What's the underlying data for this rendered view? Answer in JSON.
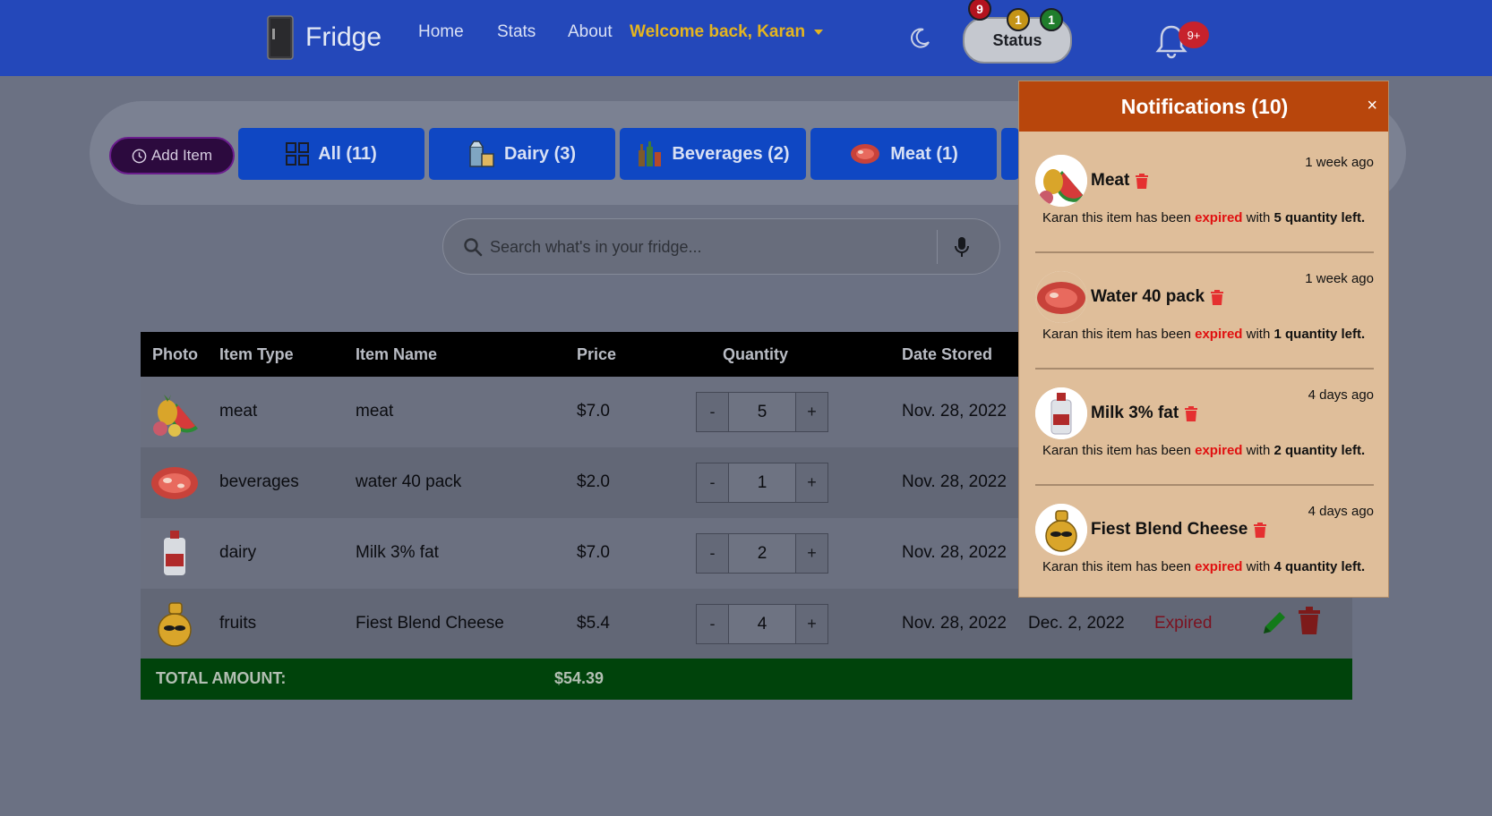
{
  "navbar": {
    "brand": "Fridge",
    "links": [
      "Home",
      "Stats",
      "About"
    ],
    "welcome": "Welcome back, Karan",
    "status_label": "Status",
    "status_badges": {
      "expired": "9",
      "warning": "1",
      "fresh": "1"
    },
    "notification_badge": "9+"
  },
  "filters": {
    "add_item": "Add Item",
    "categories": [
      "All (11)",
      "Dairy (3)",
      "Beverages (2)",
      "Meat (1)"
    ]
  },
  "search": {
    "placeholder": "Search what's in your fridge..."
  },
  "table": {
    "headers": [
      "Photo",
      "Item Type",
      "Item Name",
      "Price",
      "Quantity",
      "Date Stored"
    ],
    "rows": [
      {
        "type": "meat",
        "name": "meat",
        "price": "$7.0",
        "qty": "5",
        "stored": "Nov. 28, 2022",
        "expiry": "",
        "status": ""
      },
      {
        "type": "beverages",
        "name": "water 40 pack",
        "price": "$2.0",
        "qty": "1",
        "stored": "Nov. 28, 2022",
        "expiry": "",
        "status": ""
      },
      {
        "type": "dairy",
        "name": "Milk 3% fat",
        "price": "$7.0",
        "qty": "2",
        "stored": "Nov. 28, 2022",
        "expiry": "",
        "status": ""
      },
      {
        "type": "fruits",
        "name": "Fiest Blend Cheese",
        "price": "$5.4",
        "qty": "4",
        "stored": "Nov. 28, 2022",
        "expiry": "Dec. 2, 2022",
        "status": "Expired"
      }
    ],
    "qty_minus": "-",
    "qty_plus": "+",
    "total_label": "TOTAL AMOUNT:",
    "total_amount": "$54.39"
  },
  "notifications": {
    "title": "Notifications (10)",
    "close": "×",
    "message_prefix": "Karan this item has been",
    "expired_word": "expired",
    "with_word": "with",
    "items": [
      {
        "name": "Meat",
        "time": "1 week ago",
        "quantity": "5 quantity left."
      },
      {
        "name": "Water 40 pack",
        "time": "1 week ago",
        "quantity": "1 quantity left."
      },
      {
        "name": "Milk 3% fat",
        "time": "4 days ago",
        "quantity": "2 quantity left."
      },
      {
        "name": "Fiest Blend Cheese",
        "time": "4 days ago",
        "quantity": "4 quantity left."
      }
    ]
  },
  "colors": {
    "navbar": "#2448ba",
    "category_button": "#0f47c3",
    "notification_header": "#b8460c",
    "total_bar": "#00430b",
    "expired_red": "#e01010"
  }
}
